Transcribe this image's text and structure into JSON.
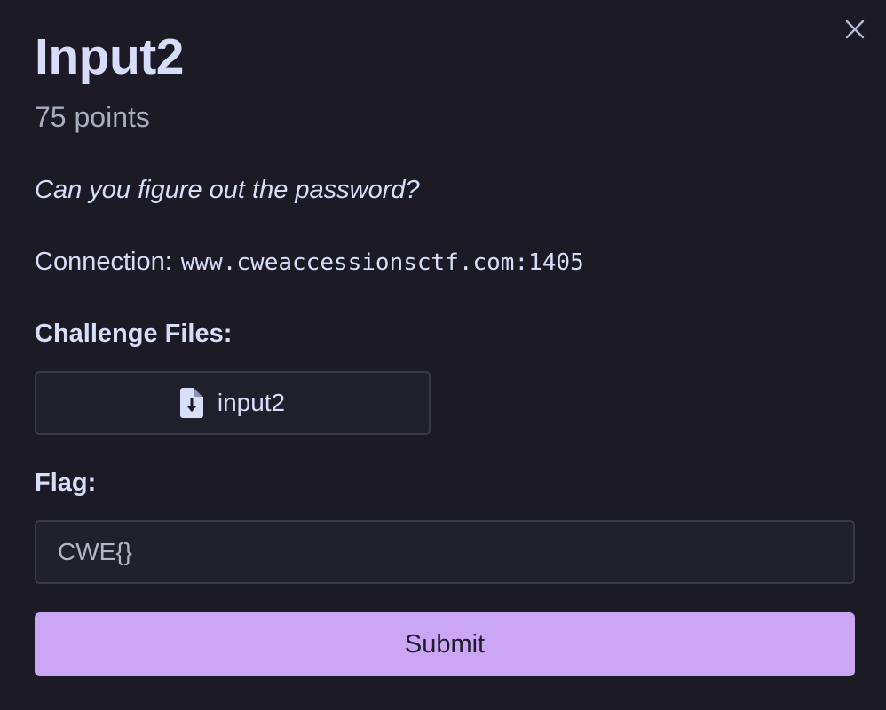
{
  "challenge": {
    "title": "Input2",
    "points": "75 points",
    "description": "Can you figure out the password?",
    "connection_label": "Connection:",
    "connection_value": "www.cweaccessionsctf.com:1405"
  },
  "files": {
    "label": "Challenge Files:",
    "items": [
      {
        "name": "input2",
        "icon": "file-download-icon"
      }
    ]
  },
  "flag": {
    "label": "Flag:",
    "placeholder": "CWE{}",
    "value": ""
  },
  "actions": {
    "submit_label": "Submit",
    "close_icon": "close-icon"
  },
  "colors": {
    "background": "#1b1a25",
    "text": "#d8defa",
    "muted": "#a9adbf",
    "border": "#393a49",
    "accent": "#cba6f5"
  }
}
